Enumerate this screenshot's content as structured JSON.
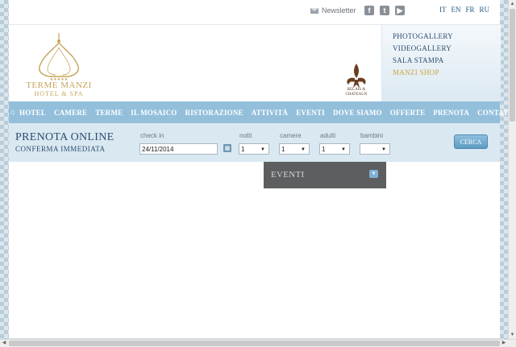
{
  "topbar": {
    "newsletter_label": "Newsletter",
    "social_icons": [
      "facebook-icon",
      "twitter-icon",
      "youtube-icon"
    ],
    "languages": [
      "IT",
      "EN",
      "FR",
      "RU"
    ]
  },
  "header": {
    "logo_title": "TERME MANZI",
    "logo_subtitle": "HOTEL & SPA",
    "relais_text": "RELAIS & CHATEAUX",
    "side_links": [
      "PHOTOGALLERY",
      "VIDEOGALLERY",
      "SALA STAMPA",
      "MANZI SHOP"
    ]
  },
  "nav": {
    "home_icon": "home-icon",
    "items": [
      "HOTEL",
      "CAMERE",
      "TERME",
      "IL MOSAICO",
      "RISTORAZIONE",
      "ATTIVITÀ",
      "EVENTI",
      "DOVE SIAMO",
      "OFFERTE",
      "PRENOTA",
      "CONTATTI"
    ]
  },
  "booking": {
    "title": "PRENOTA ONLINE",
    "subtitle": "CONFERMA IMMEDIATA",
    "checkin_label": "check in",
    "checkin_value": "24/11/2014",
    "notti_label": "notti",
    "notti_value": "1",
    "camere_label": "camere",
    "camere_value": "1",
    "adulti_label": "adulti",
    "adulti_value": "1",
    "bambini_label": "bambini",
    "bambini_value": "",
    "search_label": "CERCA"
  },
  "eventi": {
    "label": "EVENTI"
  },
  "colors": {
    "nav_bg": "#93bfdb",
    "brand_gold": "#c6a55a",
    "text_blue": "#2a4d70",
    "eventi_bg": "#5c5e60"
  }
}
